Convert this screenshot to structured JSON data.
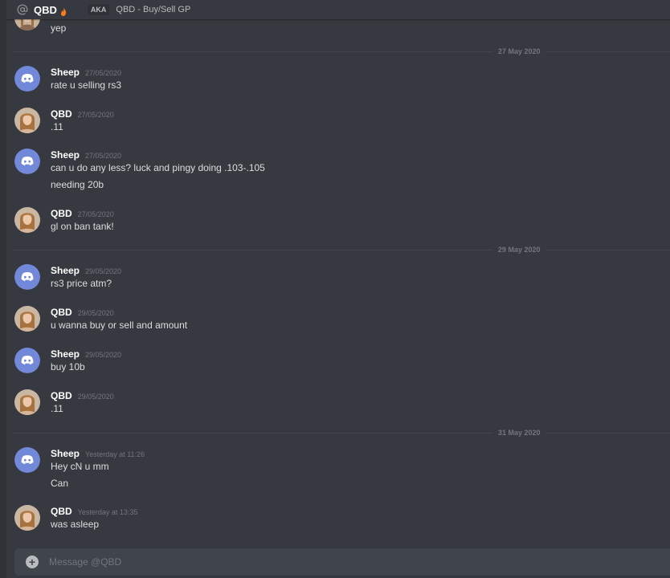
{
  "header": {
    "name": "QBD",
    "aka_badge": "AKA",
    "aka_name": "QBD - Buy/Sell GP"
  },
  "top_partial": {
    "text": "yep"
  },
  "dividers": [
    "27 May 2020",
    "29 May 2020",
    "31 May 2020"
  ],
  "messages": [
    {
      "user": "Sheep",
      "avatar": "discord",
      "time": "27/05/2020",
      "lines": [
        "rate u selling rs3"
      ]
    },
    {
      "user": "QBD",
      "avatar": "photo",
      "time": "27/05/2020",
      "lines": [
        ".11"
      ]
    },
    {
      "user": "Sheep",
      "avatar": "discord",
      "time": "27/05/2020",
      "lines": [
        "can u do any less? luck and pingy doing .103-.105",
        "needing 20b"
      ]
    },
    {
      "user": "QBD",
      "avatar": "photo",
      "time": "27/05/2020",
      "lines": [
        "gl on ban tank!"
      ]
    },
    {
      "user": "Sheep",
      "avatar": "discord",
      "time": "29/05/2020",
      "lines": [
        "rs3 price atm?"
      ]
    },
    {
      "user": "QBD",
      "avatar": "photo",
      "time": "29/05/2020",
      "lines": [
        "u wanna buy or sell and amount"
      ]
    },
    {
      "user": "Sheep",
      "avatar": "discord",
      "time": "29/05/2020",
      "lines": [
        "buy 10b"
      ]
    },
    {
      "user": "QBD",
      "avatar": "photo",
      "time": "29/05/2020",
      "lines": [
        ".11"
      ]
    },
    {
      "user": "Sheep",
      "avatar": "discord",
      "time": "Yesterday at 11:26",
      "lines": [
        "Hey cN u mm",
        "Can"
      ]
    },
    {
      "user": "QBD",
      "avatar": "photo",
      "time": "Yesterday at 13:35",
      "lines": [
        "was asleep"
      ]
    }
  ],
  "composer": {
    "placeholder": "Message @QBD"
  },
  "colors": {
    "background": "#36393f",
    "blurple": "#7289da",
    "composer": "#40444b"
  }
}
